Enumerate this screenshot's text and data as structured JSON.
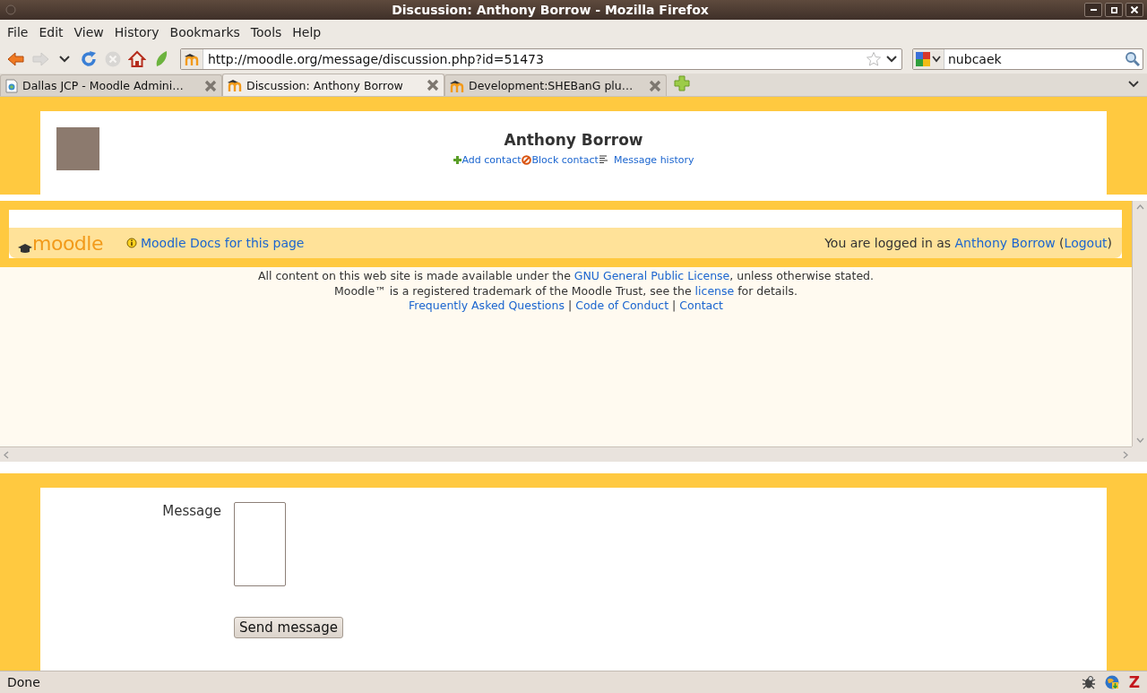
{
  "window": {
    "title": "Discussion: Anthony Borrow - Mozilla Firefox"
  },
  "menu": [
    "File",
    "Edit",
    "View",
    "History",
    "Bookmarks",
    "Tools",
    "Help"
  ],
  "navigation": {
    "buttons": [
      {
        "kind": "back",
        "disabled": false
      },
      {
        "kind": "forward",
        "disabled": true
      },
      {
        "kind": "recent",
        "disabled": false
      },
      {
        "kind": "reload",
        "disabled": false
      },
      {
        "kind": "stop",
        "disabled": true
      },
      {
        "kind": "home",
        "disabled": false
      },
      {
        "kind": "leaf",
        "disabled": false
      }
    ],
    "url": "http://moodle.org/message/discussion.php?id=51473",
    "search": {
      "value": "nubcaek"
    }
  },
  "tabs": [
    {
      "kind": "page",
      "label": "Dallas JCP - Moodle Admini…",
      "selected": false
    },
    {
      "kind": "moodle",
      "label": "Discussion: Anthony Borrow",
      "selected": true
    },
    {
      "kind": "moodle",
      "label": "Development:SHEBanG plu…",
      "selected": false
    }
  ],
  "contact": {
    "name": "Anthony Borrow",
    "actions": [
      {
        "kind": "add",
        "label": "Add contact"
      },
      {
        "kind": "block",
        "label": "Block contact"
      },
      {
        "kind": "history",
        "label": "Message history"
      }
    ]
  },
  "frame": {
    "logo": "moodle",
    "docs_link": "Moodle Docs for this page",
    "login": {
      "before": "You are logged in as ",
      "user": "Anthony Borrow",
      "middle": " (",
      "logout": "Logout",
      "after": ")"
    },
    "footer": {
      "lines": [
        {
          "before": "All content on this web site is made available under the ",
          "link": "GNU General Public License",
          "after": ", unless otherwise stated."
        },
        {
          "before": "Moodle™ is a registered trademark of the Moodle Trust, see the ",
          "link": "license",
          "after": " for details."
        }
      ],
      "links": [
        "Frequently Asked Questions",
        "Code of Conduct",
        "Contact"
      ],
      "separator": "|"
    }
  },
  "form": {
    "label": "Message",
    "button": "Send message"
  },
  "status_bar": {
    "text": "Done",
    "badge": "Z"
  }
}
